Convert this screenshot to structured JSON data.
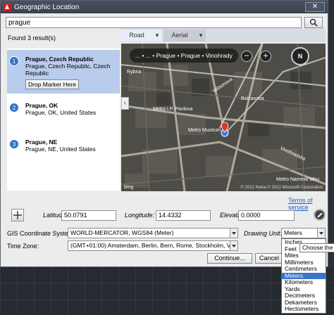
{
  "window": {
    "title": "Geographic Location",
    "close_label": "✕"
  },
  "search": {
    "value": "prague"
  },
  "results": {
    "found_text": "Found 3 result(s)",
    "items": [
      {
        "number": "1",
        "title": "Prague, Czech Republic",
        "detail": "Prague, Czech Republic, Czech Republic",
        "action": "Drop Marker Here"
      },
      {
        "number": "2",
        "title": "Prague, OK",
        "detail": "Prague, OK, United States"
      },
      {
        "number": "3",
        "title": "Prague, NE",
        "detail": "Prague, NE, United States"
      }
    ]
  },
  "map": {
    "tabs": [
      {
        "label": "Road"
      },
      {
        "label": "Aerial"
      }
    ],
    "breadcrumb": "... • ... • Prague • Prague • Vinohrady",
    "zoom_out": "−",
    "zoom_in": "+",
    "compass": "N",
    "street_labels": [
      "Wilsonova",
      "Metro I.P. Pavlova",
      "Metro Muzeum",
      "Vinohradska",
      "Metro Namesti Miru",
      "Rybna",
      "Bolzanova"
    ],
    "logo": "bing",
    "copyright": "© 2012 Nokia  © 2012 Microsoft Corporation",
    "terms": "Terms of service"
  },
  "coords": {
    "lat_label": "Latitude:",
    "lat_value": "50.0791",
    "lon_label": "Longitude:",
    "lon_value": "14.4332",
    "elev_label": "Elevation:",
    "elev_value": "0.0000"
  },
  "gis": {
    "label": "GIS Coordinate System:",
    "value": "WORLD-MERCATOR, WGS84 (Meter)",
    "unit_label": "Drawing Unit:",
    "unit_value": "Meters",
    "tz_label": "Time Zone:",
    "tz_value": "(GMT+01:00) Amsterdam, Berlin, Bern, Rome, Stockholm, Vienna"
  },
  "buttons": {
    "continue": "Continue...",
    "cancel": "Cancel"
  },
  "tooltip": "Choose the unit",
  "unit_options": [
    "Inches",
    "Feet",
    "Miles",
    "Millimeters",
    "Centimeters",
    "Meters",
    "Kilometers",
    "Yards",
    "Decimeters",
    "Dekameters",
    "Hectometers"
  ],
  "unit_selected": "Meters",
  "colors": {
    "selection": "#3a73c8",
    "result_highlight": "#b8ccec",
    "link": "#1f5fbf",
    "marker": "#d83b2a"
  }
}
